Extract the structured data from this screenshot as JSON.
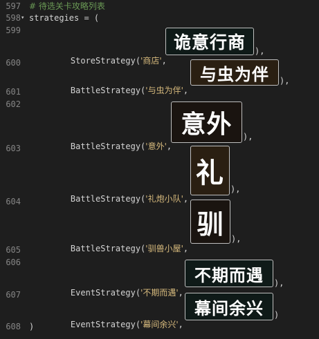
{
  "code": {
    "comment_line": {
      "number": "597",
      "text": "# 待选关卡攻略列表"
    },
    "open_line": {
      "number": "598",
      "fold": "▾",
      "text": "strategies = ("
    },
    "entries": [
      {
        "number": "599",
        "call": "StoreStrategy(",
        "arg": "'商店'",
        "sep": ", ",
        "image_text": "诡意行商",
        "close": "),"
      },
      {
        "number": "600",
        "call": "BattleStrategy(",
        "arg": "'与虫为伴'",
        "sep": ", ",
        "image_text": "与虫为伴",
        "close": "),"
      },
      {
        "number": "601"
      },
      {
        "number": "602",
        "call": "BattleStrategy(",
        "arg": "'意外'",
        "sep": ", ",
        "image_text": "意外",
        "close": "),"
      },
      {
        "number": "603",
        "call": "BattleStrategy(",
        "arg": "'礼炮小队'",
        "sep": ", ",
        "image_text": "礼",
        "close": "),"
      },
      {
        "number": "604",
        "call": "BattleStrategy(",
        "arg": "'驯兽小屋'",
        "sep": ", ",
        "image_text": "驯",
        "close": "),"
      },
      {
        "number": "605"
      },
      {
        "number": "606",
        "call": "EventStrategy(",
        "arg": "'不期而遇'",
        "sep": ", ",
        "image_text": "不期而遇",
        "close": "),"
      },
      {
        "number": "607",
        "call": "EventStrategy(",
        "arg": "'幕间余兴'",
        "sep": ", ",
        "image_text": "幕间余兴",
        "close": ")"
      }
    ],
    "close_line": {
      "number": "608",
      "text": ")"
    }
  }
}
